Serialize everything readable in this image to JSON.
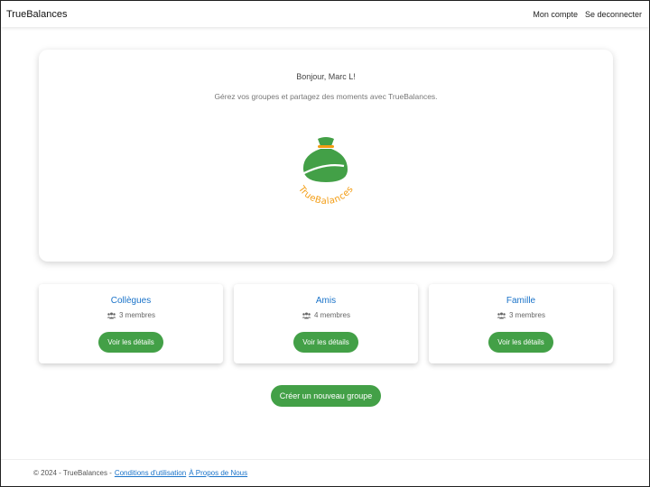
{
  "navbar": {
    "brand": "TrueBalances",
    "links": [
      "Mon compte",
      "Se deconnecter"
    ]
  },
  "hero": {
    "greeting": "Bonjour, Marc L!",
    "subtitle": "Gérez vos groupes et partagez des moments avec TrueBalances.",
    "logo_text": "TrueBalances"
  },
  "groups": [
    {
      "name": "Collègues",
      "members": "3 membres",
      "button": "Voir les détails"
    },
    {
      "name": "Amis",
      "members": "4 membres",
      "button": "Voir les détails"
    },
    {
      "name": "Famille",
      "members": "3 membres",
      "button": "Voir les détails"
    }
  ],
  "create_button": "Créer un nouveau groupe",
  "footer": {
    "copyright": "© 2024 - TrueBalances -",
    "links": [
      "Conditions d'utilisation",
      "À Propos de Nous"
    ]
  },
  "colors": {
    "accent": "#43a047",
    "link": "#1a73c9",
    "logo_orange": "#f39c12"
  },
  "icons": {
    "members": "users-icon",
    "logo": "money-bag-icon"
  }
}
